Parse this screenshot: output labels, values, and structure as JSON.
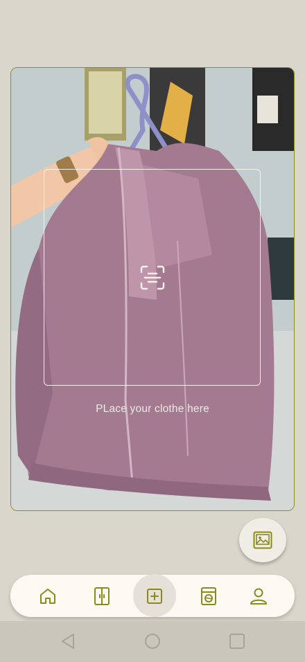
{
  "camera": {
    "hint": "PLace your clothe here"
  },
  "icons": {
    "scan": "scan-icon",
    "gallery": "image-icon",
    "home": "home-icon",
    "wardrobe": "wardrobe-icon",
    "add": "add-square-icon",
    "laundry": "washing-machine-icon",
    "profile": "user-icon",
    "back": "back-triangle-icon",
    "home_sys": "circle-home-icon",
    "recents": "square-recents-icon"
  },
  "nav": {
    "items": [
      {
        "name": "home",
        "active": false
      },
      {
        "name": "wardrobe",
        "active": false
      },
      {
        "name": "add",
        "active": true
      },
      {
        "name": "laundry",
        "active": false
      },
      {
        "name": "profile",
        "active": false
      }
    ]
  },
  "colors": {
    "accent": "#8a8a1a",
    "background": "#d9d7cb",
    "nav_background": "#fbf9f2",
    "active_bubble": "#e6e1d8"
  }
}
